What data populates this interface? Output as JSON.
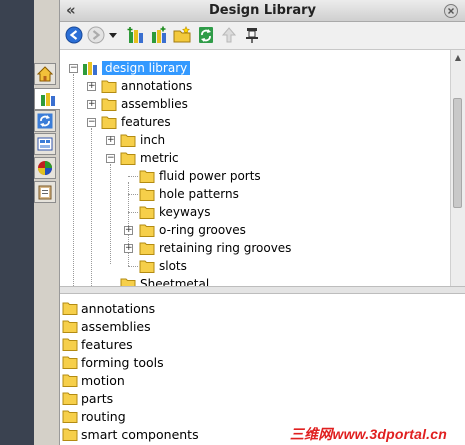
{
  "panel": {
    "title": "Design Library",
    "collapse_label": "«"
  },
  "tabs": [
    {
      "name": "home-tab",
      "icon": "house-icon"
    },
    {
      "name": "design-library-tab",
      "icon": "library-books-icon"
    },
    {
      "name": "file-explorer-tab",
      "icon": "refresh-arrows-icon"
    },
    {
      "name": "view-palette-tab",
      "icon": "palette-icon"
    },
    {
      "name": "appearances-tab",
      "icon": "color-ball-icon"
    },
    {
      "name": "custom-properties-tab",
      "icon": "clipboard-icon"
    }
  ],
  "toolbar": [
    {
      "name": "back-button",
      "icon": "back-arrow-icon"
    },
    {
      "name": "forward-button",
      "icon": "forward-arrow-icon"
    },
    {
      "name": "history-dropdown",
      "icon": "dropdown-arrow-icon"
    },
    {
      "name": "add-existing-folder-button",
      "icon": "add-library-icon"
    },
    {
      "name": "add-to-library-button",
      "icon": "add-to-library-icon"
    },
    {
      "name": "create-new-folder-button",
      "icon": "new-folder-icon"
    },
    {
      "name": "refresh-button",
      "icon": "refresh-icon"
    },
    {
      "name": "move-up-button",
      "icon": "up-arrow-icon"
    },
    {
      "name": "pin-library-button",
      "icon": "pushpin-icon"
    }
  ],
  "tree": {
    "root": "design library",
    "nodes": [
      {
        "label": "annotations"
      },
      {
        "label": "assemblies"
      },
      {
        "label": "features"
      },
      {
        "label": "inch"
      },
      {
        "label": "metric"
      },
      {
        "label": "fluid power ports"
      },
      {
        "label": "hole patterns"
      },
      {
        "label": "keyways"
      },
      {
        "label": "o-ring grooves"
      },
      {
        "label": "retaining ring grooves"
      },
      {
        "label": "slots"
      },
      {
        "label": "Sheetmetal"
      }
    ]
  },
  "folder_list": [
    "annotations",
    "assemblies",
    "features",
    "forming tools",
    "motion",
    "parts",
    "routing",
    "smart components"
  ],
  "watermark": "三维网www.3dportal.cn"
}
